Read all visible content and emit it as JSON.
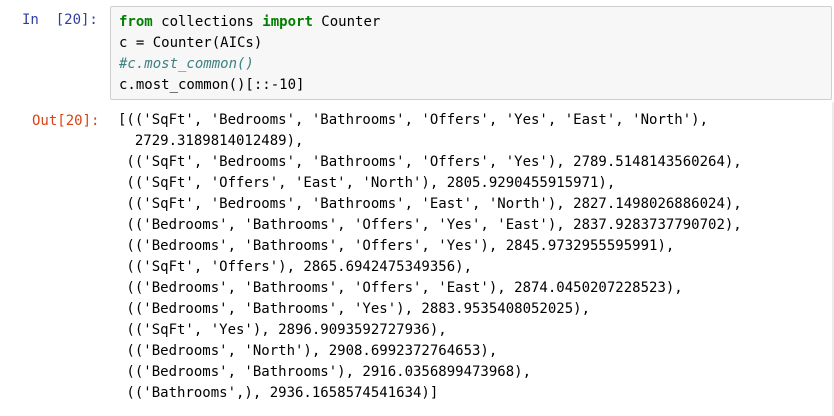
{
  "cell": {
    "in_prompt": "In  [20]:",
    "out_prompt": "Out[20]:",
    "code": {
      "kw_from": "from",
      "module": " collections ",
      "kw_import": "import",
      "name": " Counter",
      "line2": "c = Counter(AICs)",
      "comment": "#c.most_common()",
      "line4": "c.most_common()[::-10]"
    },
    "output_lines": [
      "[(('SqFt', 'Bedrooms', 'Bathrooms', 'Offers', 'Yes', 'East', 'North'),",
      "  2729.3189814012489),",
      " (('SqFt', 'Bedrooms', 'Bathrooms', 'Offers', 'Yes'), 2789.5148143560264),",
      " (('SqFt', 'Offers', 'East', 'North'), 2805.9290455915971),",
      " (('SqFt', 'Bedrooms', 'Bathrooms', 'East', 'North'), 2827.1498026886024),",
      " (('Bedrooms', 'Bathrooms', 'Offers', 'Yes', 'East'), 2837.9283737790702),",
      " (('Bedrooms', 'Bathrooms', 'Offers', 'Yes'), 2845.9732955595991),",
      " (('SqFt', 'Offers'), 2865.6942475349356),",
      " (('Bedrooms', 'Bathrooms', 'Offers', 'East'), 2874.0450207228523),",
      " (('Bedrooms', 'Bathrooms', 'Yes'), 2883.9535408052025),",
      " (('SqFt', 'Yes'), 2896.9093592727936),",
      " (('Bedrooms', 'North'), 2908.6992372764653),",
      " (('Bedrooms', 'Bathrooms'), 2916.0356899473968),",
      " (('Bathrooms',), 2936.1658574541634)]"
    ]
  }
}
